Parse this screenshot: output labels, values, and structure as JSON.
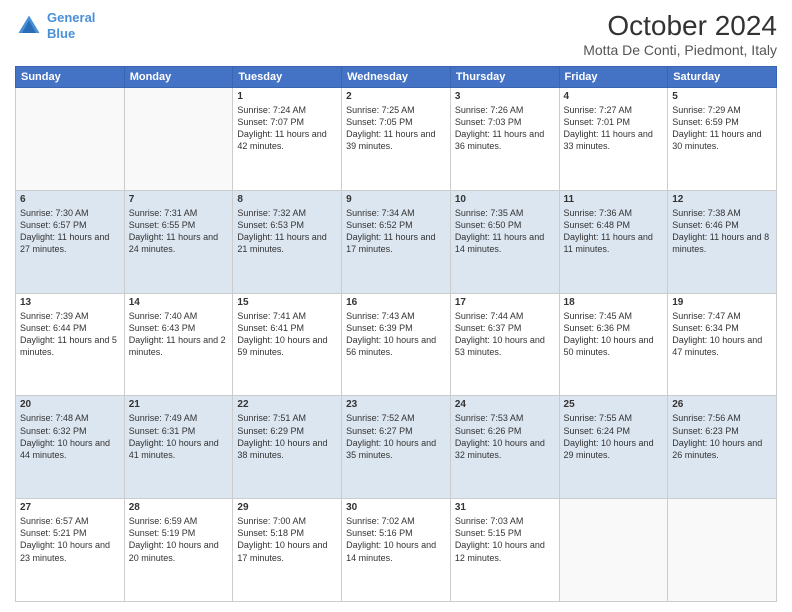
{
  "header": {
    "logo_line1": "General",
    "logo_line2": "Blue",
    "title": "October 2024",
    "subtitle": "Motta De Conti, Piedmont, Italy"
  },
  "weekdays": [
    "Sunday",
    "Monday",
    "Tuesday",
    "Wednesday",
    "Thursday",
    "Friday",
    "Saturday"
  ],
  "weeks": [
    [
      {
        "day": "",
        "content": ""
      },
      {
        "day": "",
        "content": ""
      },
      {
        "day": "1",
        "content": "Sunrise: 7:24 AM\nSunset: 7:07 PM\nDaylight: 11 hours and 42 minutes."
      },
      {
        "day": "2",
        "content": "Sunrise: 7:25 AM\nSunset: 7:05 PM\nDaylight: 11 hours and 39 minutes."
      },
      {
        "day": "3",
        "content": "Sunrise: 7:26 AM\nSunset: 7:03 PM\nDaylight: 11 hours and 36 minutes."
      },
      {
        "day": "4",
        "content": "Sunrise: 7:27 AM\nSunset: 7:01 PM\nDaylight: 11 hours and 33 minutes."
      },
      {
        "day": "5",
        "content": "Sunrise: 7:29 AM\nSunset: 6:59 PM\nDaylight: 11 hours and 30 minutes."
      }
    ],
    [
      {
        "day": "6",
        "content": "Sunrise: 7:30 AM\nSunset: 6:57 PM\nDaylight: 11 hours and 27 minutes."
      },
      {
        "day": "7",
        "content": "Sunrise: 7:31 AM\nSunset: 6:55 PM\nDaylight: 11 hours and 24 minutes."
      },
      {
        "day": "8",
        "content": "Sunrise: 7:32 AM\nSunset: 6:53 PM\nDaylight: 11 hours and 21 minutes."
      },
      {
        "day": "9",
        "content": "Sunrise: 7:34 AM\nSunset: 6:52 PM\nDaylight: 11 hours and 17 minutes."
      },
      {
        "day": "10",
        "content": "Sunrise: 7:35 AM\nSunset: 6:50 PM\nDaylight: 11 hours and 14 minutes."
      },
      {
        "day": "11",
        "content": "Sunrise: 7:36 AM\nSunset: 6:48 PM\nDaylight: 11 hours and 11 minutes."
      },
      {
        "day": "12",
        "content": "Sunrise: 7:38 AM\nSunset: 6:46 PM\nDaylight: 11 hours and 8 minutes."
      }
    ],
    [
      {
        "day": "13",
        "content": "Sunrise: 7:39 AM\nSunset: 6:44 PM\nDaylight: 11 hours and 5 minutes."
      },
      {
        "day": "14",
        "content": "Sunrise: 7:40 AM\nSunset: 6:43 PM\nDaylight: 11 hours and 2 minutes."
      },
      {
        "day": "15",
        "content": "Sunrise: 7:41 AM\nSunset: 6:41 PM\nDaylight: 10 hours and 59 minutes."
      },
      {
        "day": "16",
        "content": "Sunrise: 7:43 AM\nSunset: 6:39 PM\nDaylight: 10 hours and 56 minutes."
      },
      {
        "day": "17",
        "content": "Sunrise: 7:44 AM\nSunset: 6:37 PM\nDaylight: 10 hours and 53 minutes."
      },
      {
        "day": "18",
        "content": "Sunrise: 7:45 AM\nSunset: 6:36 PM\nDaylight: 10 hours and 50 minutes."
      },
      {
        "day": "19",
        "content": "Sunrise: 7:47 AM\nSunset: 6:34 PM\nDaylight: 10 hours and 47 minutes."
      }
    ],
    [
      {
        "day": "20",
        "content": "Sunrise: 7:48 AM\nSunset: 6:32 PM\nDaylight: 10 hours and 44 minutes."
      },
      {
        "day": "21",
        "content": "Sunrise: 7:49 AM\nSunset: 6:31 PM\nDaylight: 10 hours and 41 minutes."
      },
      {
        "day": "22",
        "content": "Sunrise: 7:51 AM\nSunset: 6:29 PM\nDaylight: 10 hours and 38 minutes."
      },
      {
        "day": "23",
        "content": "Sunrise: 7:52 AM\nSunset: 6:27 PM\nDaylight: 10 hours and 35 minutes."
      },
      {
        "day": "24",
        "content": "Sunrise: 7:53 AM\nSunset: 6:26 PM\nDaylight: 10 hours and 32 minutes."
      },
      {
        "day": "25",
        "content": "Sunrise: 7:55 AM\nSunset: 6:24 PM\nDaylight: 10 hours and 29 minutes."
      },
      {
        "day": "26",
        "content": "Sunrise: 7:56 AM\nSunset: 6:23 PM\nDaylight: 10 hours and 26 minutes."
      }
    ],
    [
      {
        "day": "27",
        "content": "Sunrise: 6:57 AM\nSunset: 5:21 PM\nDaylight: 10 hours and 23 minutes."
      },
      {
        "day": "28",
        "content": "Sunrise: 6:59 AM\nSunset: 5:19 PM\nDaylight: 10 hours and 20 minutes."
      },
      {
        "day": "29",
        "content": "Sunrise: 7:00 AM\nSunset: 5:18 PM\nDaylight: 10 hours and 17 minutes."
      },
      {
        "day": "30",
        "content": "Sunrise: 7:02 AM\nSunset: 5:16 PM\nDaylight: 10 hours and 14 minutes."
      },
      {
        "day": "31",
        "content": "Sunrise: 7:03 AM\nSunset: 5:15 PM\nDaylight: 10 hours and 12 minutes."
      },
      {
        "day": "",
        "content": ""
      },
      {
        "day": "",
        "content": ""
      }
    ]
  ]
}
